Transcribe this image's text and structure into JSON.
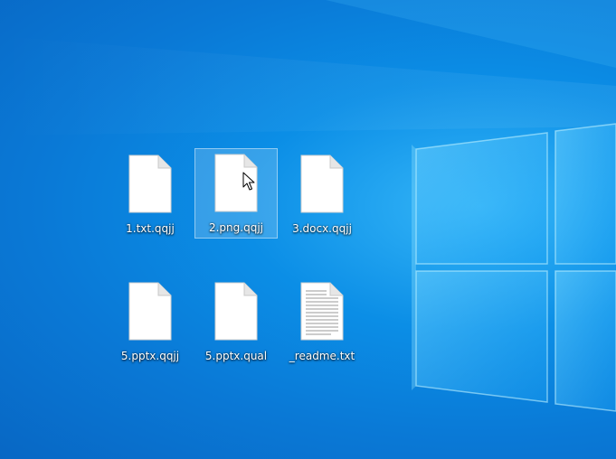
{
  "desktop": {
    "background_color": "#0a7fd9",
    "icons": [
      {
        "label": "1.txt.qqjj",
        "icon": "blank-file-icon",
        "selected": false
      },
      {
        "label": "2.png.qqjj",
        "icon": "blank-file-icon",
        "selected": true
      },
      {
        "label": "3.docx.qqjj",
        "icon": "blank-file-icon",
        "selected": false
      },
      {
        "label": "5.pptx.qqjj",
        "icon": "blank-file-icon",
        "selected": false
      },
      {
        "label": "5.pptx.qual",
        "icon": "blank-file-icon",
        "selected": false
      },
      {
        "label": "_readme.txt",
        "icon": "text-file-icon",
        "selected": false
      }
    ]
  },
  "cursor": {
    "icon": "mouse-pointer-icon"
  }
}
